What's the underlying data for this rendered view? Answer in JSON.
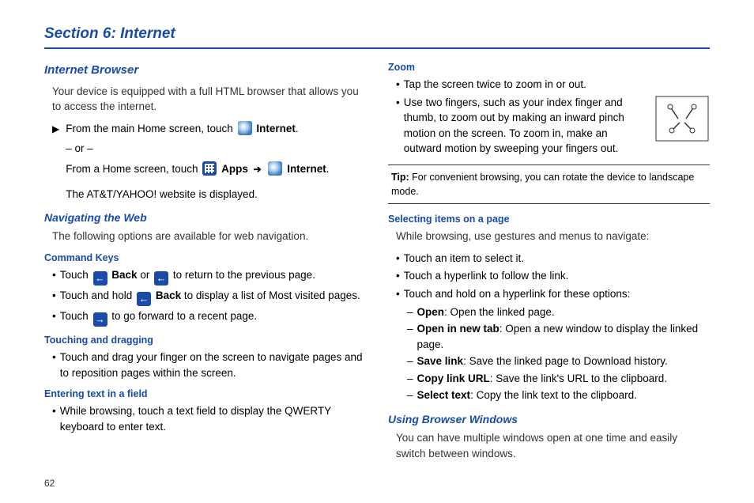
{
  "section_title": "Section 6: Internet",
  "left": {
    "h2": "Internet Browser",
    "intro": "Your device is equipped with a full HTML browser that allows you to access the internet.",
    "step1_pre": "From the main Home screen, touch ",
    "internet_label": "Internet",
    "or": "– or –",
    "step2_pre": "From a Home screen, touch ",
    "apps_label": "Apps",
    "step2_post": "Internet",
    "displayed": "The AT&T/YAHOO! website is displayed.",
    "nav_h3": "Navigating the Web",
    "nav_intro": "The following options are available for web navigation.",
    "cmd_h4": "Command Keys",
    "cmd1_pre": "Touch ",
    "back_label": "Back",
    "cmd1_mid": " or ",
    "cmd1_post": " to return to the previous page.",
    "cmd2_pre": "Touch and hold ",
    "cmd2_post": " to display a list of Most visited pages.",
    "cmd3_pre": "Touch ",
    "cmd3_post": " to go forward to a recent page.",
    "touch_h4": "Touching and dragging",
    "touch1": "Touch and drag your finger on the screen to navigate pages and to reposition pages within the screen.",
    "enter_h4": "Entering text in a field",
    "enter1": "While browsing, touch a text field to display the QWERTY keyboard to enter text."
  },
  "right": {
    "zoom_h4": "Zoom",
    "zoom1": "Tap the screen twice to zoom in or out.",
    "zoom2": "Use two fingers, such as your index finger and thumb, to zoom out by making an inward pinch motion on the screen. To zoom in, make an outward motion by sweeping your fingers out.",
    "tip_label": "Tip:",
    "tip_text": " For convenient browsing, you can rotate the device to landscape mode.",
    "sel_h4": "Selecting items on a page",
    "sel_intro": "While browsing, use gestures and menus to navigate:",
    "sel1": "Touch an item to select it.",
    "sel2": "Touch a hyperlink to follow the link.",
    "sel3": "Touch and hold on a hyperlink for these options:",
    "opt1_l": "Open",
    "opt1_t": ": Open the linked page.",
    "opt2_l": "Open in new tab",
    "opt2_t": ": Open a new window to display the linked page.",
    "opt3_l": "Save link",
    "opt3_t": ": Save the linked page to Download history.",
    "opt4_l": "Copy link URL",
    "opt4_t": ": Save the link's URL to the clipboard.",
    "opt5_l": "Select text",
    "opt5_t": ": Copy the link text to the clipboard.",
    "win_h3": "Using Browser Windows",
    "win_intro": "You can have multiple windows open at one time and easily switch between windows."
  },
  "page_number": "62"
}
